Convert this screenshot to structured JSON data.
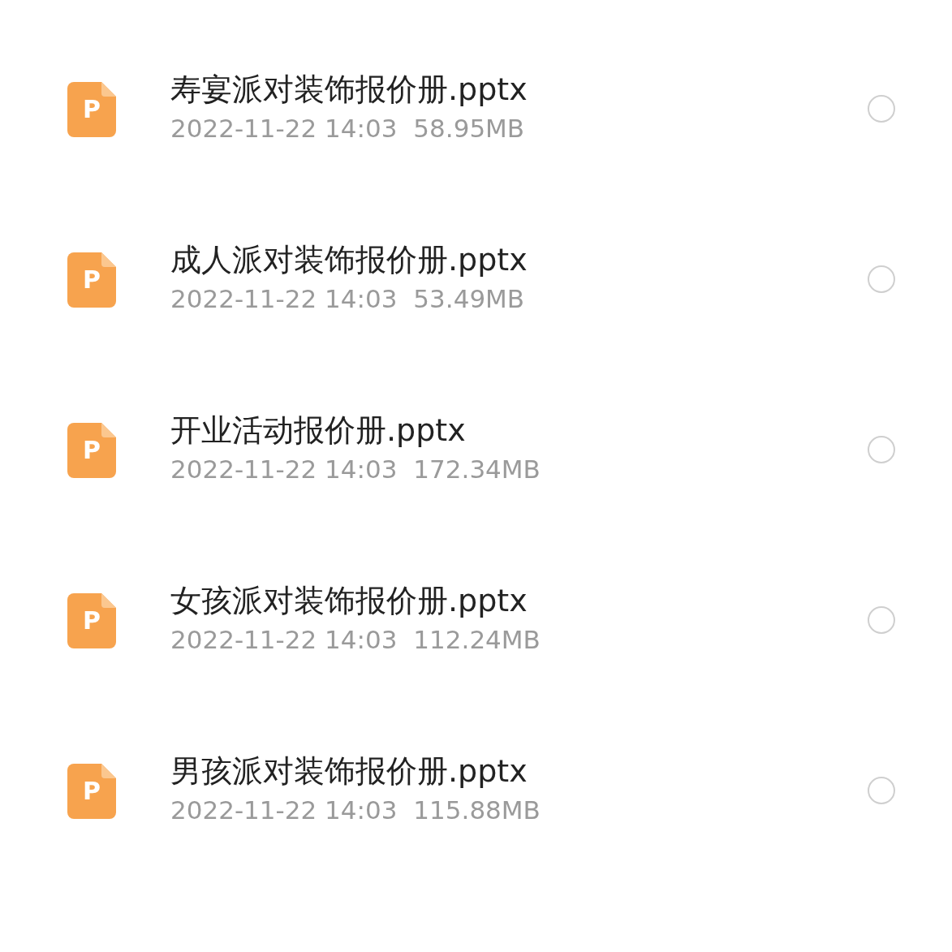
{
  "files": [
    {
      "icon_label": "P",
      "name": "寿宴派对装饰报价册.pptx",
      "date": "2022-11-22 14:03",
      "size": "58.95MB",
      "selected": false
    },
    {
      "icon_label": "P",
      "name": "成人派对装饰报价册.pptx",
      "date": "2022-11-22 14:03",
      "size": "53.49MB",
      "selected": false
    },
    {
      "icon_label": "P",
      "name": "开业活动报价册.pptx",
      "date": "2022-11-22 14:03",
      "size": "172.34MB",
      "selected": false
    },
    {
      "icon_label": "P",
      "name": "女孩派对装饰报价册.pptx",
      "date": "2022-11-22 14:03",
      "size": "112.24MB",
      "selected": false
    },
    {
      "icon_label": "P",
      "name": "男孩派对装饰报价册.pptx",
      "date": "2022-11-22 14:03",
      "size": "115.88MB",
      "selected": false
    }
  ]
}
